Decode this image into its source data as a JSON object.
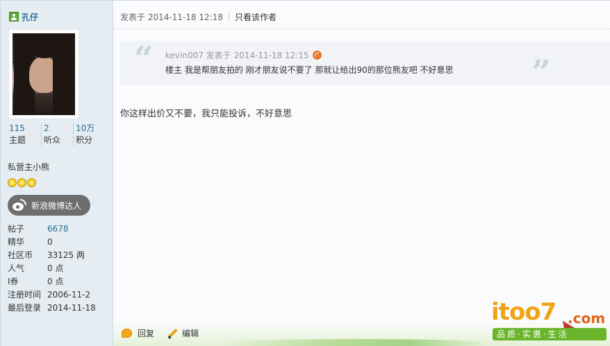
{
  "author": {
    "name": "孔仔",
    "stats": [
      {
        "num": "115",
        "label": "主题"
      },
      {
        "num": "2",
        "label": "听众"
      },
      {
        "num": "10万",
        "label": "积分"
      }
    ],
    "group": "私营主小熊",
    "weibo_badge": "新浪微博达人",
    "info": [
      {
        "label": "帖子",
        "value": "6678"
      },
      {
        "label": "精华",
        "value": "0"
      },
      {
        "label": "社区币",
        "value": "33125 两"
      },
      {
        "label": "人气",
        "value": "0 点"
      },
      {
        "label": "I券",
        "value": "0 点"
      },
      {
        "label": "注册时间",
        "value": "2006-11-2"
      },
      {
        "label": "最后登录",
        "value": "2014-11-18"
      }
    ]
  },
  "post": {
    "posted": "发表于 2014-11-18 12:18",
    "only_author": "只看该作者",
    "quote": {
      "meta": "kevin007 发表于 2014-11-18 12:15",
      "text": "楼主 我是帮朋友拍的  刚才朋友说不要了  那就让给出90的那位熊友吧  不好意思"
    },
    "body": "你这样出价又不要，我只能投诉，不好意思",
    "actions": {
      "reply": "回复",
      "edit": "编辑"
    }
  },
  "watermark": {
    "logo_text": "itoo7",
    "logo_domain": ".com",
    "slogan": "品质·实惠·生活"
  },
  "colors": {
    "accent_link": "#2a6d94",
    "sidebar_bg": "#e5edf2",
    "logo_orange": "#f2a313",
    "logo_green": "#6bb52d"
  },
  "icons": [
    "online-user-icon",
    "sun-level-icon",
    "weibo-icon",
    "back-to-quote-icon",
    "reply-icon",
    "edit-icon"
  ]
}
